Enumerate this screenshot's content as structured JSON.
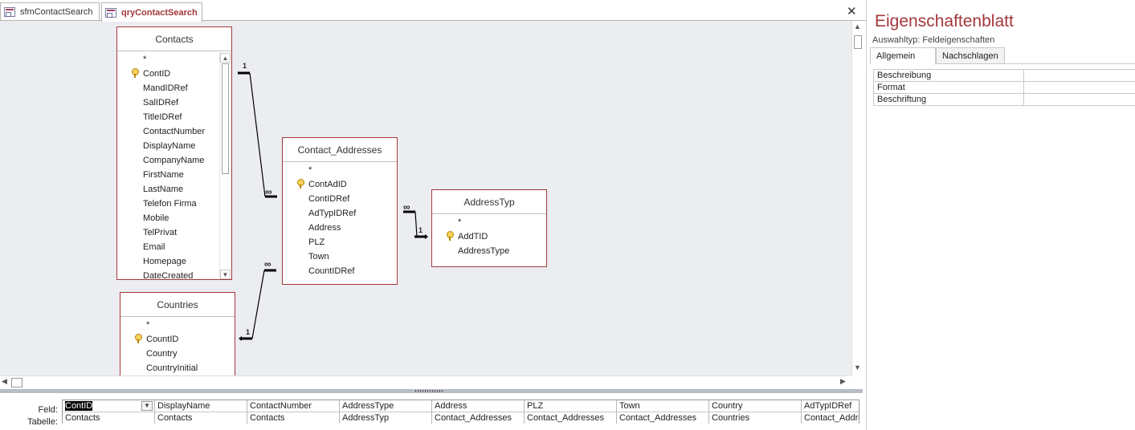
{
  "tabs": [
    {
      "label": "sfmContactSearch",
      "active": false
    },
    {
      "label": "qryContactSearch",
      "active": true
    }
  ],
  "close_label": "✕",
  "tables": {
    "contacts": {
      "title": "Contacts",
      "fields": [
        "*",
        "ContID",
        "MandIDRef",
        "SalIDRef",
        "TitleIDRef",
        "ContactNumber",
        "DisplayName",
        "CompanyName",
        "FirstName",
        "LastName",
        "Telefon Firma",
        "Mobile",
        "TelPrivat",
        "Email",
        "Homepage",
        "DateCreated"
      ]
    },
    "contact_addresses": {
      "title": "Contact_Addresses",
      "fields": [
        "*",
        "ContAdID",
        "ContIDRef",
        "AdTypIDRef",
        "Address",
        "PLZ",
        "Town",
        "CountIDRef"
      ]
    },
    "addresstyp": {
      "title": "AddressTyp",
      "fields": [
        "*",
        "AddTID",
        "AddressType"
      ]
    },
    "countries": {
      "title": "Countries",
      "fields": [
        "*",
        "CountID",
        "Country",
        "CountryInitial"
      ]
    }
  },
  "relations": {
    "one": "1",
    "many": "∞"
  },
  "qbe": {
    "row_labels": {
      "field": "Feld:",
      "table": "Tabelle:"
    },
    "columns": [
      {
        "field": "ContID",
        "table": "Contacts"
      },
      {
        "field": "DisplayName",
        "table": "Contacts"
      },
      {
        "field": "ContactNumber",
        "table": "Contacts"
      },
      {
        "field": "AddressType",
        "table": "AddressTyp"
      },
      {
        "field": "Address",
        "table": "Contact_Addresses"
      },
      {
        "field": "PLZ",
        "table": "Contact_Addresses"
      },
      {
        "field": "Town",
        "table": "Contact_Addresses"
      },
      {
        "field": "Country",
        "table": "Countries"
      },
      {
        "field": "AdTypIDRef",
        "table": "Contact_Addresses"
      }
    ]
  },
  "property_sheet": {
    "title": "Eigenschaftenblatt",
    "selection_type": "Auswahltyp:  Feldeigenschaften",
    "tabs": [
      "Allgemein",
      "Nachschlagen"
    ],
    "properties": [
      {
        "name": "Beschreibung",
        "value": ""
      },
      {
        "name": "Format",
        "value": ""
      },
      {
        "name": "Beschriftung",
        "value": ""
      }
    ]
  },
  "colors": {
    "accent": "#a4373a",
    "canvas": "#ebedf0"
  }
}
